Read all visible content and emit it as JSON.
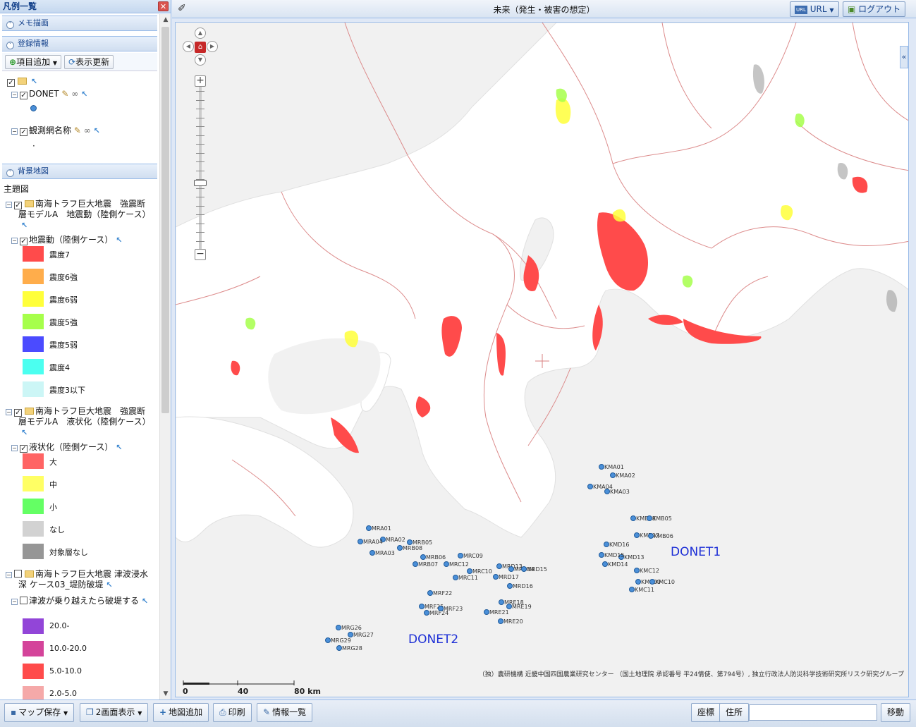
{
  "legend_panel": {
    "title": "凡例一覧",
    "close_glyph": "✕",
    "sections": {
      "memo": "メモ描画",
      "registered": "登録情報",
      "background": "背景地図"
    },
    "toolbar": {
      "add_item": "項目追加",
      "refresh": "表示更新"
    },
    "registered_items": [
      {
        "label": "DONET"
      },
      {
        "label": "観測網名称"
      }
    ],
    "thematic_label": "主題図",
    "groups": [
      {
        "title_line1": "南海トラフ巨大地震　強震断",
        "title_line2": "層モデルA　地震動（陸側ケース）",
        "layer": "地震動（陸側ケース）",
        "items": [
          {
            "label": "震度7",
            "color": "#ff4b4b"
          },
          {
            "label": "震度6強",
            "color": "#ffad4b"
          },
          {
            "label": "震度6弱",
            "color": "#ffff3a"
          },
          {
            "label": "震度5強",
            "color": "#a6ff4b"
          },
          {
            "label": "震度5弱",
            "color": "#4b4bff"
          },
          {
            "label": "震度4",
            "color": "#4bfff0"
          },
          {
            "label": "震度3以下",
            "color": "#ccf6f6"
          }
        ]
      },
      {
        "title_line1": "南海トラフ巨大地震　強震断",
        "title_line2": "層モデルA　液状化（陸側ケース）",
        "layer": "液状化（陸側ケース）",
        "items": [
          {
            "label": "大",
            "color": "#ff6464"
          },
          {
            "label": "中",
            "color": "#ffff64"
          },
          {
            "label": "小",
            "color": "#64ff64"
          },
          {
            "label": "なし",
            "color": "#d2d2d2"
          },
          {
            "label": "対象層なし",
            "color": "#969696"
          }
        ]
      },
      {
        "title_line1": "南海トラフ巨大地震 津波浸水",
        "title_line2": "深 ケース03_堤防破堤",
        "layer": "津波が乗り越えたら破堤する",
        "items": [
          {
            "label": "20.0-",
            "color": "#9245d8"
          },
          {
            "label": "10.0-20.0",
            "color": "#d4449a"
          },
          {
            "label": "5.0-10.0",
            "color": "#ff4b4b"
          },
          {
            "label": "2.0-5.0",
            "color": "#f5a9a9"
          }
        ]
      }
    ]
  },
  "map_header": {
    "title": "未来（発生・被害の想定）",
    "url_button": "URL",
    "logout_button": "ログアウト"
  },
  "map": {
    "network_labels": [
      "DONET1",
      "DONET2"
    ],
    "stations": [
      "KMA01",
      "KMA02",
      "KMA04",
      "KMA03",
      "KMB08",
      "KMB05",
      "KMB07",
      "KMB06",
      "KMD16",
      "KMD13",
      "KMD14",
      "KMD15",
      "KMC12",
      "KMC09",
      "KMC10",
      "KMC11",
      "MRA01",
      "MRA02",
      "MRA04",
      "MRB08",
      "MRA03",
      "MRB05",
      "MRB06",
      "MRB07",
      "MRC09",
      "MRC12",
      "MRC10",
      "MRC11",
      "MRD13",
      "MRD14",
      "MRD15",
      "MRD17",
      "MRD16",
      "MRF22",
      "MRF25",
      "MRF23",
      "MRF24",
      "MRE18",
      "MRE19",
      "MRE21",
      "MRE20",
      "MRG26",
      "MRG27",
      "MRG29",
      "MRG28"
    ],
    "attribution": "（独）農研機構 近畿中国四国農業研究センター （国土地理院 承認番号 平24情使、第794号）, 独立行政法人防災科学技術研究所リスク研究グループ",
    "scale_labels": [
      "0",
      "40",
      "80 km"
    ],
    "colors": {
      "sea": "#f1f1f1",
      "land": "#ffffff",
      "boundary": "#d98080",
      "intensity7": "#ff4b4b",
      "intensity6u": "#ffff3a",
      "intensity5u": "#a6ff4b",
      "gray": "#969696"
    }
  },
  "bottom_bar": {
    "save_map": "マップ保存",
    "dual_view": "2画面表示",
    "add_map": "地図追加",
    "print": "印刷",
    "info_list": "情報一覧",
    "coords": "座標",
    "address": "住所",
    "coord_placeholder": "",
    "move": "移動"
  }
}
